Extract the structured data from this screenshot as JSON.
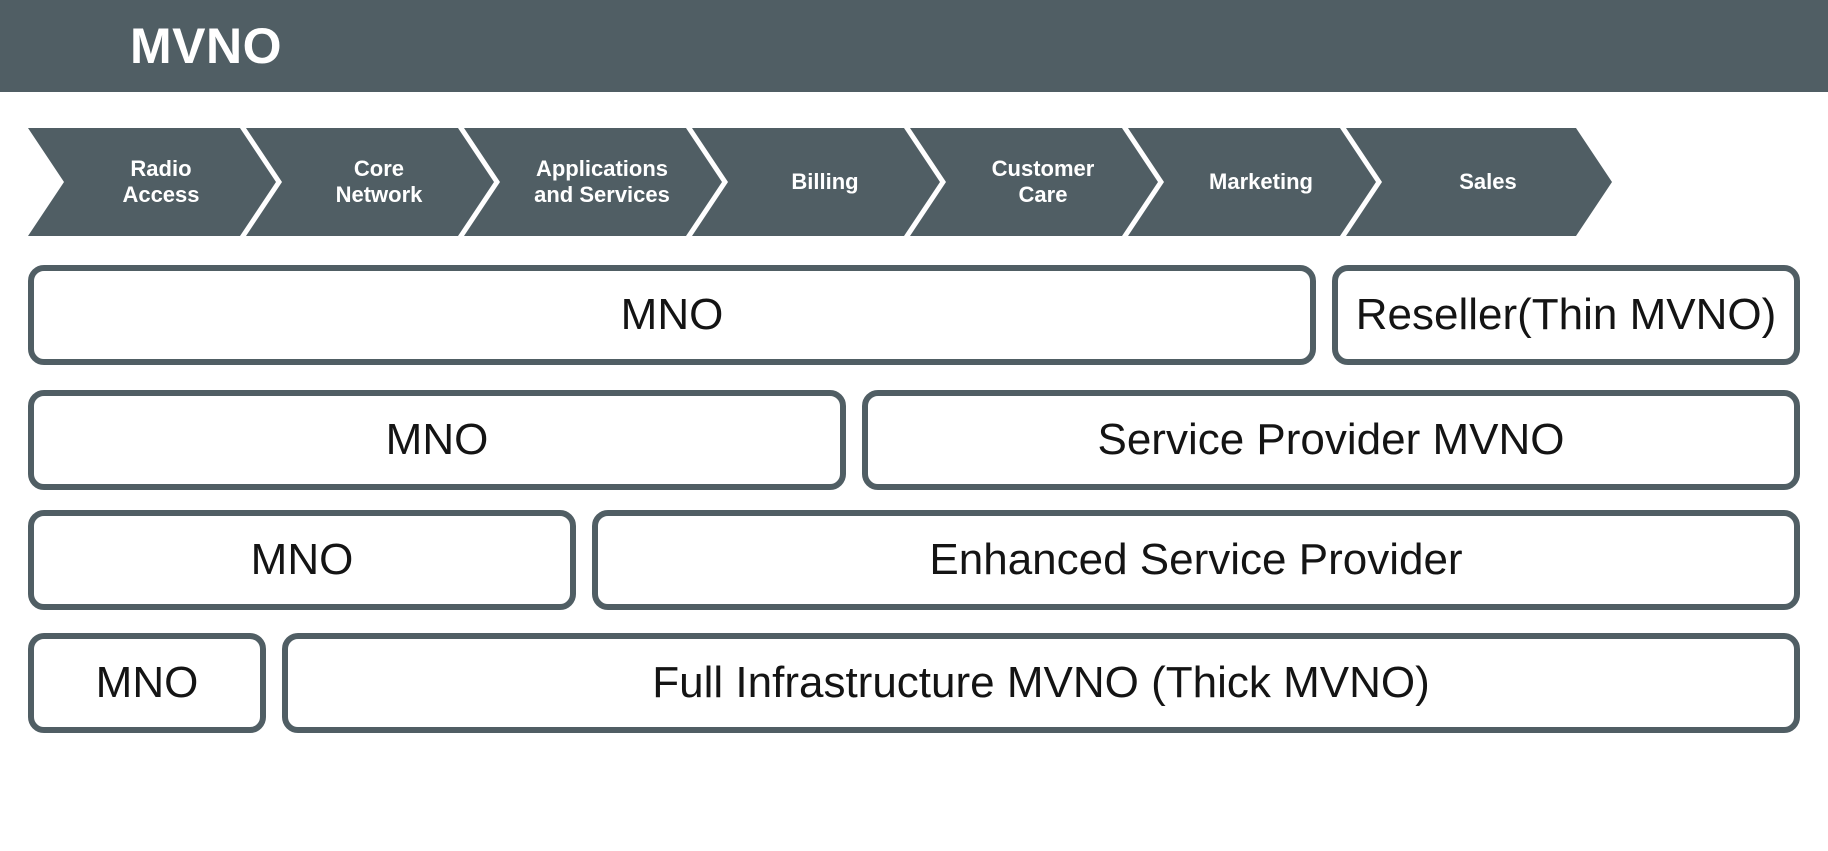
{
  "header": {
    "title": "MVNO",
    "background_color": "#505E64",
    "text_color": "#FFFFFF"
  },
  "value_chain": {
    "accent_color": "#505E64",
    "steps": [
      {
        "label": "Radio\nAccess",
        "name": "radio-access"
      },
      {
        "label": "Core\nNetwork",
        "name": "core-network"
      },
      {
        "label": "Applications\nand Services",
        "name": "applications-and-services"
      },
      {
        "label": "Billing",
        "name": "billing"
      },
      {
        "label": "Customer\nCare",
        "name": "customer-care"
      },
      {
        "label": "Marketing",
        "name": "marketing"
      },
      {
        "label": "Sales",
        "name": "sales"
      }
    ]
  },
  "models": [
    {
      "name": "reseller",
      "operator_label": "MNO",
      "mvno_label": "Reseller(Thin MVNO)"
    },
    {
      "name": "service-provider-mvno",
      "operator_label": "MNO",
      "mvno_label": "Service Provider MVNO"
    },
    {
      "name": "enhanced-service-provider",
      "operator_label": "MNO",
      "mvno_label": "Enhanced Service Provider"
    },
    {
      "name": "full-infrastructure-mvno",
      "operator_label": "MNO",
      "mvno_label": "Full Infrastructure MVNO (Thick MVNO)"
    }
  ],
  "colors": {
    "slate": "#505E64",
    "text": "#141414",
    "background": "#FFFFFF"
  }
}
